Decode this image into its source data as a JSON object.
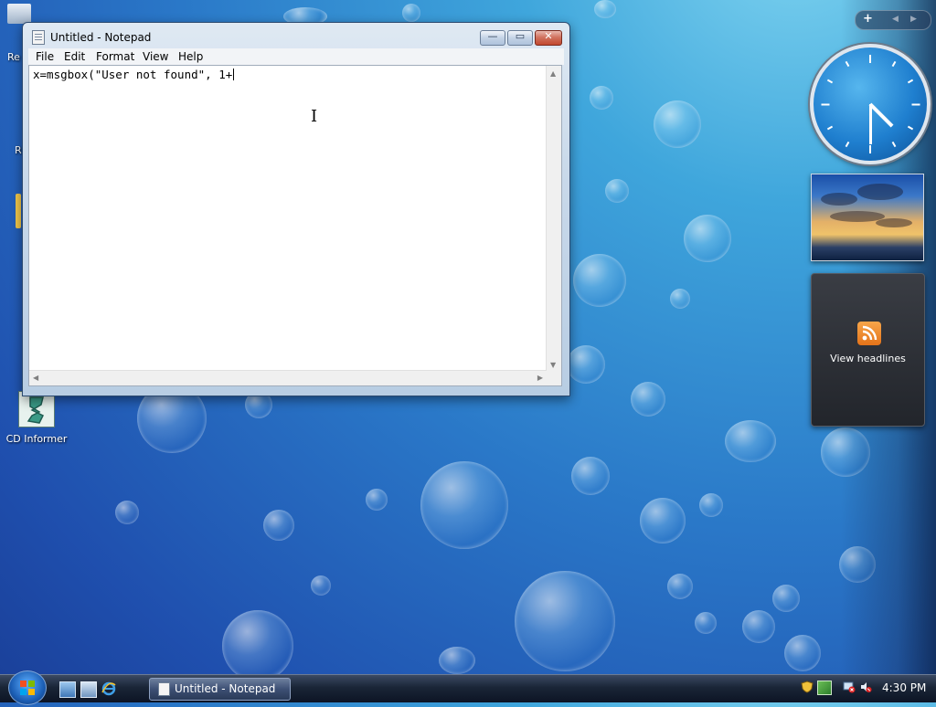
{
  "desktop": {
    "icons": [
      {
        "label": "Re"
      },
      {
        "label": "R"
      },
      {
        "label": "CD Informer"
      }
    ]
  },
  "notepad": {
    "title": "Untitled - Notepad",
    "menu": [
      "File",
      "Edit",
      "Format",
      "View",
      "Help"
    ],
    "content": "x=msgbox(\"User not found\", 1+",
    "caption_buttons": {
      "minimize": "—",
      "maximize": "▭",
      "close": "✕"
    }
  },
  "gadgets": {
    "control": {
      "add": "+",
      "prev": "◀",
      "next": "▶"
    },
    "clock": {
      "hour": 4,
      "minute": 30
    },
    "feed": {
      "label": "View headlines"
    }
  },
  "taskbar": {
    "task_label": "Untitled - Notepad",
    "time": "4:30 PM"
  },
  "colors": {
    "taskbar": "#1a2537",
    "rss_orange": "#e4731a",
    "desktop_blue": "#2a78c8"
  }
}
